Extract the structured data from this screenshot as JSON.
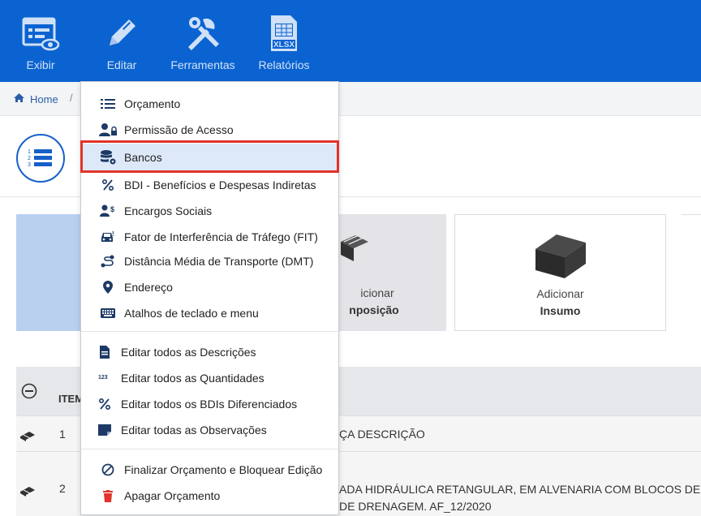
{
  "toolbar": {
    "items": [
      {
        "label": "Exibir",
        "icon": "view-list-icon"
      },
      {
        "label": "Editar",
        "icon": "pencil-icon"
      },
      {
        "label": "Ferramentas",
        "icon": "tools-icon"
      },
      {
        "label": "Relatórios",
        "icon": "xlsx-file-icon"
      }
    ]
  },
  "breadcrumb": {
    "home": "Home",
    "separator": "/"
  },
  "cards": {
    "composicao_line1": "icionar",
    "composicao_line2": "nposição",
    "insumo_line1": "Adicionar",
    "insumo_line2": "Insumo"
  },
  "table": {
    "header_item": "ITEM",
    "rows": [
      {
        "item": "1",
        "desc": "ÇA DESCRIÇÃO"
      },
      {
        "item": "2",
        "desc": "ADA HIDRÁULICA RETANGULAR, EM ALVENARIA COM BLOCOS DE CON",
        "desc2": "DE DRENAGEM. AF_12/2020"
      }
    ]
  },
  "menu": {
    "group1": [
      {
        "label": "Orçamento",
        "icon": "list-icon"
      },
      {
        "label": "Permissão de Acesso",
        "icon": "user-lock-icon"
      },
      {
        "label": "Bancos",
        "icon": "database-gear-icon",
        "selected": true
      },
      {
        "label": "BDI - Benefícios e Despesas Indiretas",
        "icon": "percent-icon"
      },
      {
        "label": "Encargos Sociais",
        "icon": "users-dollar-icon"
      },
      {
        "label": "Fator de Interferência de Tráfego (FIT)",
        "icon": "car-icon"
      },
      {
        "label": "Distância Média de Transporte (DMT)",
        "icon": "route-icon"
      },
      {
        "label": "Endereço",
        "icon": "map-pin-icon"
      },
      {
        "label": "Atalhos de teclado e menu",
        "icon": "keyboard-icon"
      }
    ],
    "group2": [
      {
        "label": "Editar todos as Descrições",
        "icon": "document-icon"
      },
      {
        "label": "Editar todos as Quantidades",
        "icon": "numbers-icon"
      },
      {
        "label": "Editar todos os BDIs Diferenciados",
        "icon": "percent-icon"
      },
      {
        "label": "Editar todas as Observações",
        "icon": "note-icon"
      }
    ],
    "group3": [
      {
        "label": "Finalizar Orçamento e Bloquear Edição",
        "icon": "ban-icon"
      },
      {
        "label": "Apagar Orçamento",
        "icon": "trash-icon"
      }
    ]
  },
  "colors": {
    "toolbar": "#0a63d1",
    "highlight_border": "#e0332b",
    "selected_bg": "#dde9f8",
    "trash": "#e0332b"
  }
}
